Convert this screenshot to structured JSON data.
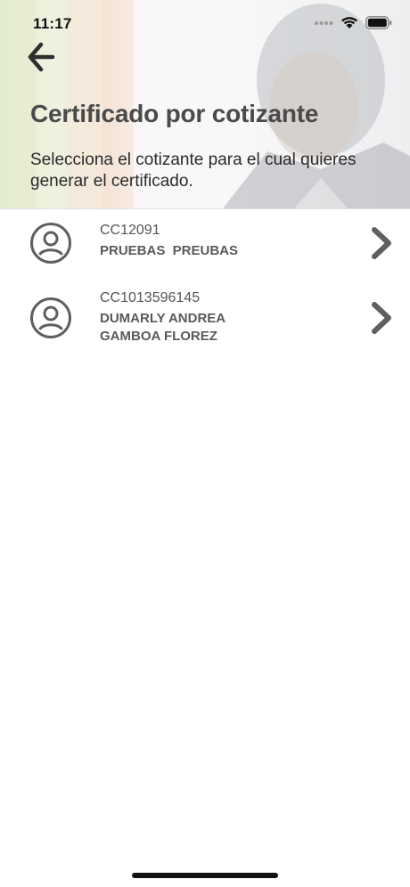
{
  "status_bar": {
    "time": "11:17",
    "icons": [
      "signal-dots-icon",
      "wifi-icon",
      "battery-icon"
    ]
  },
  "header": {
    "back_icon": "arrow-left-icon",
    "title": "Certificado por cotizante",
    "subtitle": "Selecciona el cotizante para el cual quieres generar el certificado."
  },
  "contributors": [
    {
      "id": "CC12091",
      "name_line1": "PRUEBAS  PREUBAS",
      "name_line2": ""
    },
    {
      "id": "CC1013596145",
      "name_line1": "DUMARLY ANDREA",
      "name_line2": "GAMBOA FLOREZ"
    }
  ],
  "colors": {
    "title": "#4a4a4a",
    "icon_gray": "#5f5f5f",
    "divider": "#e2e2e2"
  }
}
